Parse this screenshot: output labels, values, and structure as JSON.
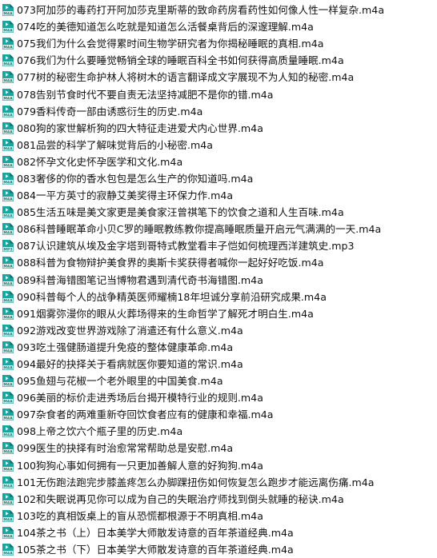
{
  "files": [
    {
      "name": "073阿加莎的毒药打开阿加莎克里斯蒂的致命药房看药性如何像人性一样复杂.m4a",
      "type": "m4a",
      "badge": "M4A"
    },
    {
      "name": "074吃的美德知道怎么吃就是知道怎么活餐桌背后的深邃理解.m4a",
      "type": "m4a",
      "badge": "M4A"
    },
    {
      "name": "075我们为什么会觉得累时间生物学研究者为你揭秘睡眠的真相.m4a",
      "type": "m4a",
      "badge": "M4A"
    },
    {
      "name": "076我们为什么要睡觉畅销全球的睡眠百科全书如何获得高质量睡眠.m4a",
      "type": "m4a",
      "badge": "M4A"
    },
    {
      "name": "077树的秘密生命护林人将树木的语言翻译成文字展现不为人知的秘密.m4a",
      "type": "m4a",
      "badge": "M4A"
    },
    {
      "name": "078告别节食时代不要自责无法坚持减肥不是你的错.m4a",
      "type": "m4a",
      "badge": "M4A"
    },
    {
      "name": "079香料传奇一部由诱惑衍生的历史.m4a",
      "type": "m4a",
      "badge": "M4A"
    },
    {
      "name": "080狗的家世解析狗的四大特征走进爱犬内心世界.m4a",
      "type": "m4a",
      "badge": "M4A"
    },
    {
      "name": "081品尝的科学了解味觉背后的小秘密.m4a",
      "type": "m4a",
      "badge": "M4A"
    },
    {
      "name": "082怀孕文化史怀孕医学和文化.m4a",
      "type": "m4a",
      "badge": "M4A"
    },
    {
      "name": "083奢侈的你的香水包包是怎么生产的你知道吗.m4a",
      "type": "m4a",
      "badge": "M4A"
    },
    {
      "name": "084一平方英寸的寂静艾美奖得主环保力作.m4a",
      "type": "m4a",
      "badge": "M4A"
    },
    {
      "name": "085生活五味是美文家更是美食家汪曾祺笔下的饮食之道和人生百味.m4a",
      "type": "m4a",
      "badge": "M4A"
    },
    {
      "name": "086科普睡眠革命小贝C罗的睡眠教练教你提高睡眠质量开启元气满满的一天.m4a",
      "type": "m4a",
      "badge": "M4A"
    },
    {
      "name": "087认识建筑从埃及金字塔到哥特式教堂看丰子恺如何梳理西洋建筑史.mp3",
      "type": "mp3",
      "badge": "MP3"
    },
    {
      "name": "088科普为食物辩护美食界的奥斯卡奖获得者喊你一起好好吃饭.m4a",
      "type": "m4a",
      "badge": "M4A"
    },
    {
      "name": "089科普海错图笔记当博物君遇到清代奇书海错图.m4a",
      "type": "m4a",
      "badge": "M4A"
    },
    {
      "name": "090科普每个人的战争精英医师耀楠18年坦诚分享前沿研究成果.m4a",
      "type": "m4a",
      "badge": "M4A"
    },
    {
      "name": "091烟雾弥漫你的眼从火葬场得来的生命哲学了解死才明白生.m4a",
      "type": "m4a",
      "badge": "M4A"
    },
    {
      "name": "092游戏改变世界游戏除了消遣还有什么意义.m4a",
      "type": "m4a",
      "badge": "M4A"
    },
    {
      "name": "093吃土强健肠道提升免疫的整体健康革命.m4a",
      "type": "m4a",
      "badge": "M4A"
    },
    {
      "name": "094最好的抉择关于看病就医你要知道的常识.m4a",
      "type": "m4a",
      "badge": "M4A"
    },
    {
      "name": "095鱼翅与花椒一个老外眼里的中国美食.m4a",
      "type": "m4a",
      "badge": "M4A"
    },
    {
      "name": "096美丽的标价走进秀场后台揭开模特行业的规则.m4a",
      "type": "m4a",
      "badge": "M4A"
    },
    {
      "name": "097杂食者的两难重新夺回饮食者应有的健康和幸福.m4a",
      "type": "m4a",
      "badge": "M4A"
    },
    {
      "name": "098上帝之饮六个瓶子里的历史.m4a",
      "type": "m4a",
      "badge": "M4A"
    },
    {
      "name": "099医生的抉择有时治愈常常帮助总是安慰.m4a",
      "type": "m4a",
      "badge": "M4A"
    },
    {
      "name": "100狗狗心事如何拥有一只更加善解人意的好狗狗.m4a",
      "type": "m4a",
      "badge": "M4A"
    },
    {
      "name": "101无伤跑法跑完步膝盖疼怎么办脚踝扭伤如何恢复怎么跑步才能远离伤痛.m4a",
      "type": "m4a",
      "badge": "M4A"
    },
    {
      "name": "102和失眠说再见你可以成为自己的失眠治疗师找到倒头就睡的秘诀.m4a",
      "type": "m4a",
      "badge": "M4A"
    },
    {
      "name": "103吃的真相饭桌上的盲从恐慌都根源于不明真相.m4a",
      "type": "m4a",
      "badge": "M4A"
    },
    {
      "name": "104茶之书（上）日本美学大师散发诗意的百年茶道经典.m4a",
      "type": "m4a",
      "badge": "M4A"
    },
    {
      "name": "105茶之书（下）日本美学大师散发诗意的百年茶道经典.m4a",
      "type": "m4a",
      "badge": "M4A"
    }
  ],
  "colors": {
    "icon_fill": "#1aa5a0",
    "icon_fold": "#0d6f6b",
    "icon_band": "#e8f6f5",
    "icon_text": "#137d79",
    "text": "#111111"
  },
  "icon": "audio-file-icon"
}
